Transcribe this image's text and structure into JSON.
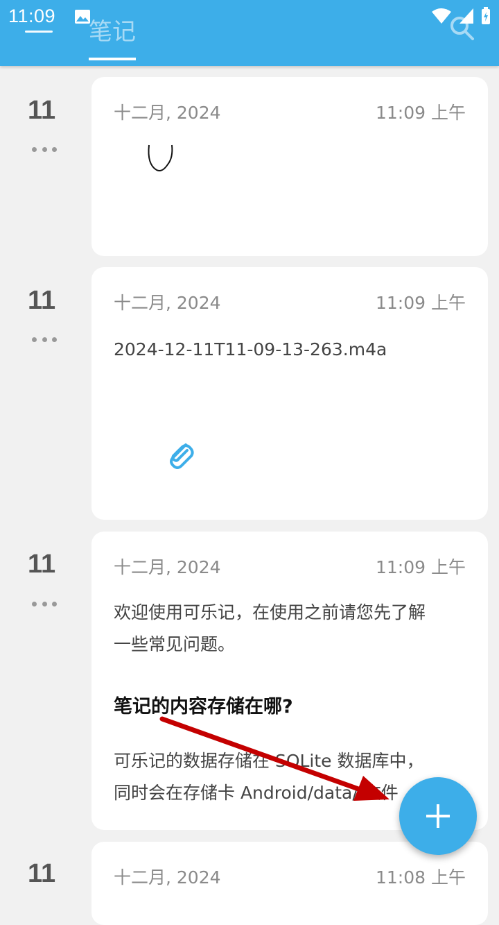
{
  "status_bar": {
    "time": "11:09"
  },
  "app_bar": {
    "tab_label": "笔记"
  },
  "notes": [
    {
      "day": "11",
      "date": "十二月, 2024",
      "time": "11:09 上午"
    },
    {
      "day": "11",
      "date": "十二月, 2024",
      "time": "11:09 上午",
      "text": "2024-12-11T11-09-13-263.m4a"
    },
    {
      "day": "11",
      "date": "十二月, 2024",
      "time": "11:09 上午",
      "intro_line1": "欢迎使用可乐记，在使用之前请您先了解",
      "intro_line2": "一些常见问题。",
      "heading": "笔记的内容存储在哪?",
      "body_line1": "可乐记的数据存储在 SQLite 数据库中，",
      "body_line2": "同时会在存储卡 Android/data/ 文件"
    },
    {
      "day": "11",
      "date": "十二月, 2024",
      "time": "11:08 上午"
    }
  ],
  "fab": {
    "label": "+"
  },
  "colors": {
    "primary": "#3daee9",
    "annotation_arrow": "#c40000"
  }
}
